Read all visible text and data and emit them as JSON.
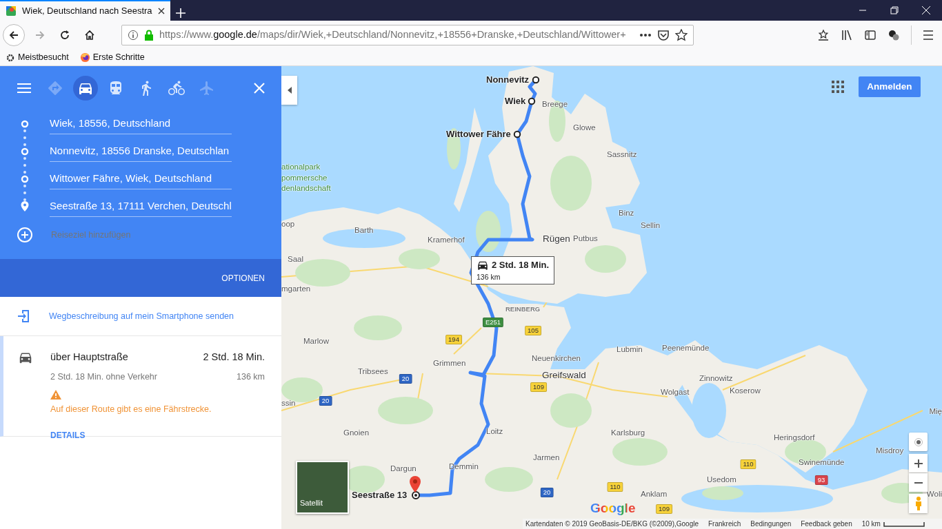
{
  "browser": {
    "tab_title": "Wiek, Deutschland nach Seestra",
    "url": "https://www.**google.de**/maps/dir/Wiek,+Deutschland/Nonnevitz,+18556+Dranske,+Deutschland/Wittower+",
    "bookmarks": [
      {
        "kind": "gear",
        "label": "Meistbesucht"
      },
      {
        "kind": "firefox",
        "label": "Erste Schritte"
      }
    ]
  },
  "directions": {
    "modes": [
      {
        "kind": "best",
        "selected": false,
        "disabled": true
      },
      {
        "kind": "car",
        "selected": true,
        "disabled": false
      },
      {
        "kind": "transit",
        "selected": false,
        "disabled": false
      },
      {
        "kind": "walk",
        "selected": false,
        "disabled": false
      },
      {
        "kind": "bike",
        "selected": false,
        "disabled": false
      },
      {
        "kind": "flight",
        "selected": false,
        "disabled": true
      }
    ],
    "stops": [
      {
        "kind": "waypoint",
        "value": "Wiek, 18556, Deutschland"
      },
      {
        "kind": "waypoint",
        "value": "Nonnevitz, 18556 Dranske, Deutschlan"
      },
      {
        "kind": "waypoint",
        "value": "Wittower Fähre, Wiek, Deutschland"
      },
      {
        "kind": "destination",
        "value": "Seestraße 13, 17111 Verchen, Deutschl"
      }
    ],
    "add_destination": {
      "placeholder": "Reiseziel hinzufügen"
    },
    "options_label": "OPTIONEN",
    "send_to_phone": "Wegbeschreibung auf mein Smartphone senden",
    "routes": [
      {
        "selected": true,
        "title": "über Hauptstraße",
        "duration": "2 Std. 18 Min.",
        "subtitle": "2 Std. 18 Min. ohne Verkehr",
        "distance": "136 km",
        "warning": "Auf dieser Route gibt es eine Fährstrecke.",
        "details_label": "DETAILS"
      }
    ]
  },
  "map": {
    "places": [
      {
        "kind": "waypoint",
        "name": "Nonnevitz"
      },
      {
        "kind": "waypoint",
        "name": "Wiek"
      },
      {
        "kind": "town",
        "name": "Breege"
      },
      {
        "kind": "town",
        "name": "Glowe"
      },
      {
        "kind": "waypoint",
        "name": "Wittower Fähre"
      },
      {
        "kind": "town",
        "name": "Sassnitz"
      },
      {
        "kind": "park",
        "name": "ationalpark"
      },
      {
        "kind": "park",
        "name": "pommersche"
      },
      {
        "kind": "park",
        "name": "denlandschaft"
      },
      {
        "kind": "town",
        "name": "oop"
      },
      {
        "kind": "town",
        "name": "Binz"
      },
      {
        "kind": "town",
        "name": "Barth"
      },
      {
        "kind": "town",
        "name": "Sellin"
      },
      {
        "kind": "town",
        "name": "Kramerhof"
      },
      {
        "kind": "city",
        "name": "Rügen"
      },
      {
        "kind": "town",
        "name": "Putbus"
      },
      {
        "kind": "town",
        "name": "Saal"
      },
      {
        "kind": "town",
        "name": "mgarten"
      },
      {
        "kind": "district",
        "name": "REINBERG"
      },
      {
        "kind": "road",
        "name": "E251",
        "color": "#3e8e41"
      },
      {
        "kind": "road",
        "name": "105",
        "color": "#f7d23a"
      },
      {
        "kind": "road",
        "name": "194",
        "color": "#f7d23a"
      },
      {
        "kind": "town",
        "name": "Marlow"
      },
      {
        "kind": "town",
        "name": "Lubmin"
      },
      {
        "kind": "town",
        "name": "Peenemünde"
      },
      {
        "kind": "town",
        "name": "Neuenkirchen"
      },
      {
        "kind": "town",
        "name": "Grimmen"
      },
      {
        "kind": "town",
        "name": "Tribsees"
      },
      {
        "kind": "city",
        "name": "Greifswald"
      },
      {
        "kind": "road",
        "name": "20",
        "color": "#2f66c4"
      },
      {
        "kind": "town",
        "name": "Zinnowitz"
      },
      {
        "kind": "road",
        "name": "109",
        "color": "#f7d23a"
      },
      {
        "kind": "town",
        "name": "Wolgast"
      },
      {
        "kind": "town",
        "name": "Koserow"
      },
      {
        "kind": "road",
        "name": "20",
        "color": "#2f66c4"
      },
      {
        "kind": "town",
        "name": "ssin"
      },
      {
        "kind": "town",
        "name": "Mię"
      },
      {
        "kind": "town",
        "name": "Gnoien"
      },
      {
        "kind": "town",
        "name": "Loitz"
      },
      {
        "kind": "town",
        "name": "Karlsburg"
      },
      {
        "kind": "town",
        "name": "Heringsdorf"
      },
      {
        "kind": "town",
        "name": "Misdroy"
      },
      {
        "kind": "town",
        "name": "Jarmen"
      },
      {
        "kind": "town",
        "name": "Swinemünde"
      },
      {
        "kind": "road",
        "name": "110",
        "color": "#f7d23a"
      },
      {
        "kind": "town",
        "name": "Dargun"
      },
      {
        "kind": "town",
        "name": "Demmin"
      },
      {
        "kind": "town",
        "name": "Usedom"
      },
      {
        "kind": "road",
        "name": "93",
        "color": "#d9434b"
      },
      {
        "kind": "destination",
        "name": "Seestraße 13"
      },
      {
        "kind": "road",
        "name": "110",
        "color": "#f7d23a"
      },
      {
        "kind": "road",
        "name": "20",
        "color": "#2f66c4"
      },
      {
        "kind": "town",
        "name": "Anklam"
      },
      {
        "kind": "town",
        "name": "Woli"
      },
      {
        "kind": "road",
        "name": "109",
        "color": "#f7d23a"
      }
    ],
    "route_label": {
      "duration": "2 Std. 18 Min.",
      "distance": "136 km"
    },
    "sign_in": "Anmelden",
    "layer_label": "Satellit",
    "logo": "Google",
    "footer": [
      "Kartendaten © 2019 GeoBasis-DE/BKG (©2009),Google",
      "Frankreich",
      "Bedingungen",
      "Feedback geben"
    ],
    "scale": "10 km"
  }
}
